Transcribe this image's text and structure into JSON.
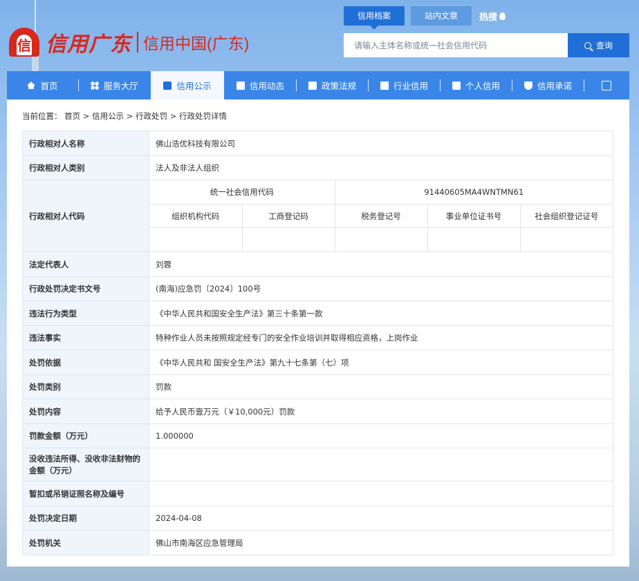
{
  "header": {
    "logo_script": "信用广东",
    "logo_text": "信用中国(广东)",
    "search_tabs": [
      "信用档案",
      "站内文章"
    ],
    "active_search_tab": 0,
    "hot_label": "热搜",
    "search_placeholder": "请输入主体名称或统一社会信用代码",
    "search_button": "查询"
  },
  "nav": {
    "items": [
      {
        "label": "首页",
        "icon": "home-icon"
      },
      {
        "label": "服务大厅",
        "icon": "grid-icon"
      },
      {
        "label": "信用公示",
        "icon": "briefcase-icon"
      },
      {
        "label": "信用动态",
        "icon": "document-icon"
      },
      {
        "label": "政策法规",
        "icon": "book-icon"
      },
      {
        "label": "行业信用",
        "icon": "building-icon"
      },
      {
        "label": "个人信用",
        "icon": "person-card-icon"
      },
      {
        "label": "信用承诺",
        "icon": "shield-check-icon"
      }
    ],
    "active_index": 2,
    "colors": {
      "bar": "#3a86e8",
      "active_bg": "#f4f7fb",
      "active_text": "#1f6fd6"
    }
  },
  "breadcrumb": "当前位置： 首页 > 信用公示 > 行政处罚 > 行政处罚详情",
  "details": {
    "name_label": "行政相对人名称",
    "name_value": "佛山浩优科技有限公司",
    "type_label": "行政相对人类别",
    "type_value": "法人及非法人组织",
    "code_label": "行政相对人代码",
    "codes": {
      "uscc_label": "统一社会信用代码",
      "uscc_value": "91440605MA4WNTMN61",
      "sub_headers": [
        "组织机构代码",
        "工商登记码",
        "税务登记号",
        "事业单位证书号",
        "社会组织登记证号"
      ],
      "sub_values": [
        "",
        "",
        "",
        "",
        ""
      ]
    },
    "rows": [
      {
        "label": "法定代表人",
        "value": "刘蓉"
      },
      {
        "label": "行政处罚决定书文号",
        "value": "(南海)应急罚〔2024〕100号"
      },
      {
        "label": "违法行为类型",
        "value": "《中华人民共和国安全生产法》第三十条第一款"
      },
      {
        "label": "违法事实",
        "value": "特种作业人员未按照规定经专门的安全作业培训并取得相应资格，上岗作业"
      },
      {
        "label": "处罚依据",
        "value": "《中华人民共和 国安全生产法》第九十七条第（七）项"
      },
      {
        "label": "处罚类别",
        "value": "罚款"
      },
      {
        "label": "处罚内容",
        "value": "给予人民币壹万元（￥10,000元）罚款"
      },
      {
        "label": "罚款金额（万元）",
        "value": "1.000000"
      },
      {
        "label": "没收违法所得、没收非法财物的金额（万元）",
        "value": ""
      },
      {
        "label": "暂扣或吊销证照名称及编号",
        "value": ""
      },
      {
        "label": "处罚决定日期",
        "value": "2024-04-08"
      },
      {
        "label": "处罚机关",
        "value": "佛山市南海区应急管理局"
      }
    ]
  }
}
